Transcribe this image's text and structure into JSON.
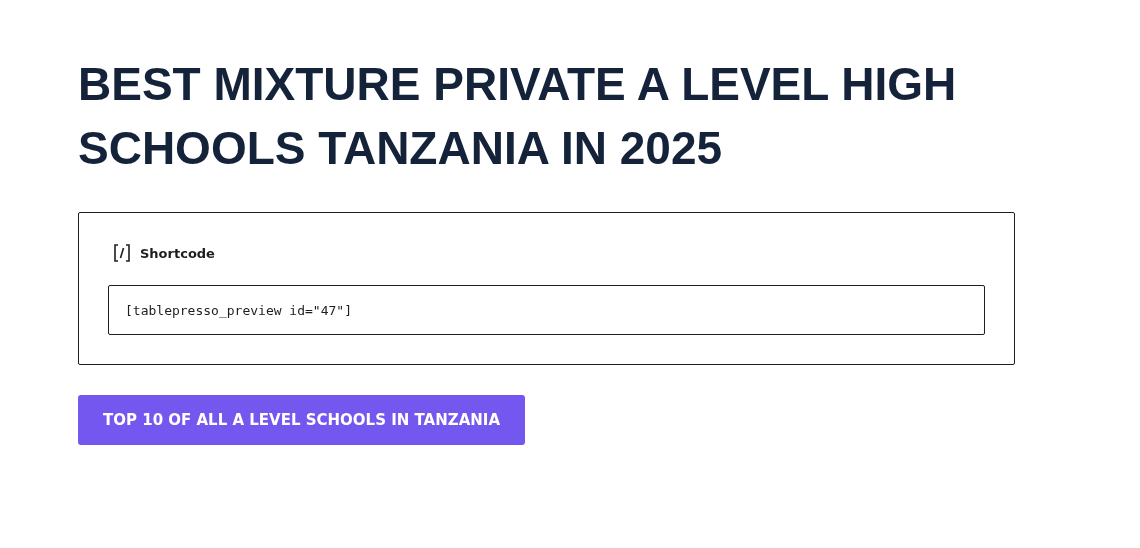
{
  "title": "BEST MIXTURE PRIVATE A LEVEL HIGH SCHOOLS TANZANIA IN 2025",
  "shortcode_block": {
    "label": "Shortcode",
    "value": "[tablepresso_preview id=\"47\"]"
  },
  "button": {
    "label": "TOP 10 OF ALL A LEVEL SCHOOLS IN TANZANIA"
  }
}
